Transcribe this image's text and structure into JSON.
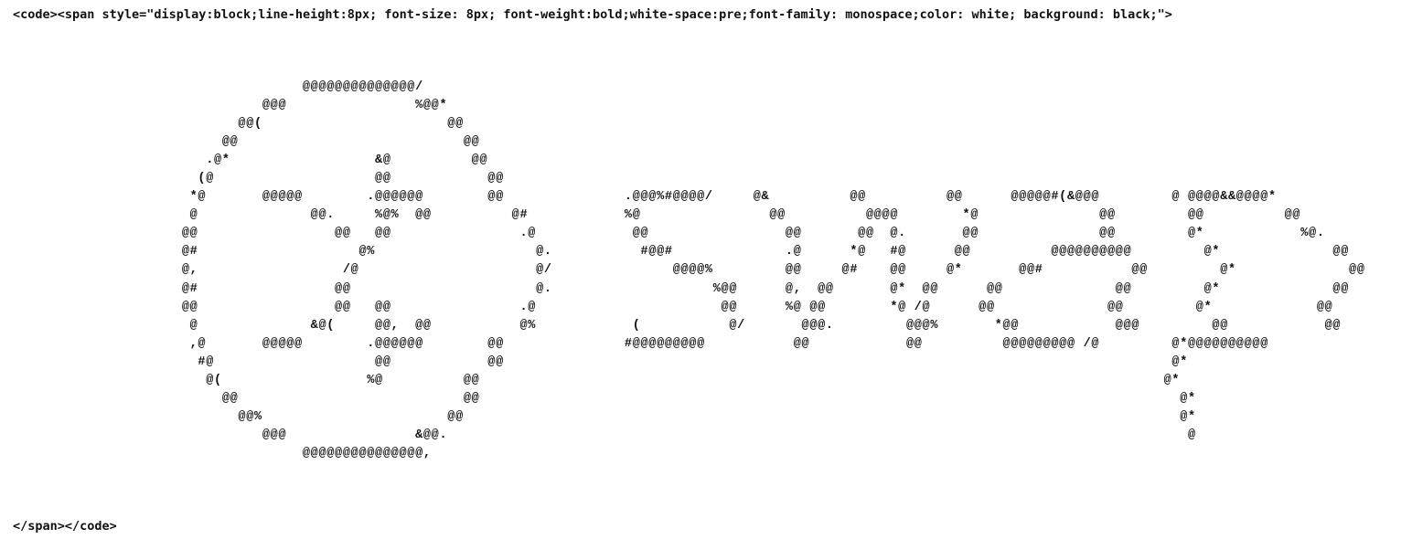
{
  "code": {
    "open_tag": "<code><span style=\"display:block;line-height:8px; font-size: 8px; font-weight:bold;white-space:pre;font-family: monospace;color: white; background: black;\">",
    "close_tag": "</span></code>"
  },
  "ascii_art": {
    "lines": [
      "                                    @@@@@@@@@@@@@@/                                                                                                                  ",
      "                               @@@                %@@*                                                                                                                ",
      "                            @@(                       @@                                                                                                              ",
      "                          @@                            @@                                                                                                            ",
      "                        .@*                  &@          @@                                                                                                          ",
      "                       (@                    @@            @@                                                                                                         ",
      "                      *@       @@@@@        .@@@@@@        @@               .@@@%#@@@@/     @&          @@          @@      @@@@@#(&@@@         @ @@@@&&@@@@*          ",
      "                      @              @@.     %@%  @@          @#            %@                @@          @@@@        *@               @@         @@          @@           ",
      "                     @@                 @@   @@                .@            @@                 @@       @@  @.       @@               @@         @*            %@.        ",
      "                     @#                    @%                    @.           #@@#              .@      *@   #@      @@          @@@@@@@@@@         @*              @@         ",
      "                     @,                  /@                      @/               @@@@%         @@     @#    @@     @*       @@#           @@         @*              @@         ",
      "                     @#                 @@                       @.                    %@@      @,  @@       @*  @@      @@              @@         @*              @@         ",
      "                     @@                 @@   @@                .@                       @@      %@ @@        *@ /@      @@              @@         @*             @@          ",
      "                      @              &@(     @@,  @@           @%            (           @/       @@@.         @@@%       *@@            @@@         @@            @@           ",
      "                      ,@       @@@@@        .@@@@@@        @@               #@@@@@@@@@           @@            @@          @@@@@@@@@ /@         @*@@@@@@@@@@                ",
      "                       #@                    @@            @@                                                                                   @*                         ",
      "                        @(                  %@          @@                                                                                     @*                         ",
      "                          @@                            @@                                                                                       @*                         ",
      "                            @@%                       @@                                                                                         @*                         ",
      "                               @@@                &@@.                                                                                            @                          ",
      "                                    @@@@@@@@@@@@@@@,                                                                                                                  "
    ]
  }
}
